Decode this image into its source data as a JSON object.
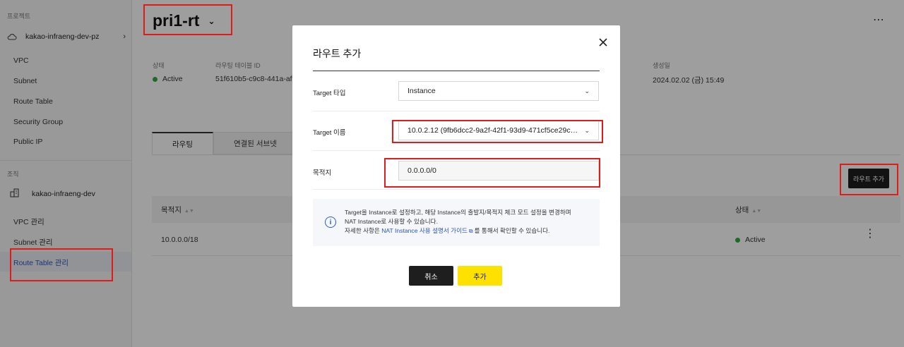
{
  "sidebar": {
    "project_section_label": "프로젝트",
    "project_name": "kakao-infraeng-dev-pz",
    "project_chevron": "›",
    "project_icon": "cloud-icon",
    "vpc_items": [
      "VPC",
      "Subnet",
      "Route Table",
      "Security Group",
      "Public IP"
    ],
    "org_section_label": "조직",
    "org_name": "kakao-infraeng-dev",
    "org_icon": "building-icon",
    "org_items": [
      "VPC 관리",
      "Subnet 관리",
      "Route Table 관리"
    ]
  },
  "header": {
    "title": "pri1-rt",
    "caret": "⌄",
    "more_menu": "⋯"
  },
  "meta": {
    "status_label": "상태",
    "status_value": "Active",
    "routing_table_id_label": "라우팅 테이블 ID",
    "routing_table_id_value": "51f610b5-c9c8-441a-afc",
    "created_label": "생성일",
    "created_value": "2024.02.02 (금) 15:49"
  },
  "tabs": [
    "라우팅",
    "연결된 서브넷"
  ],
  "toolbar": {
    "add_route_label": "라우트 추가"
  },
  "table": {
    "headers": [
      "목적지",
      "상태"
    ],
    "sort_icon": "▲▼",
    "rows": [
      {
        "destination": "10.0.0.0/18",
        "status": "Active"
      }
    ],
    "row_menu": "⋮"
  },
  "modal": {
    "title": "라우트 추가",
    "close_icon": "close-icon",
    "target_type_label": "Target 타입",
    "target_type_value": "Instance",
    "target_name_label": "Target 이름",
    "target_name_value": "10.0.2.12 (9fb6dcc2-9a2f-42f1-93d9-471cf5ce29c…",
    "destination_label": "목적지",
    "destination_value": "0.0.0.0/0",
    "info_line1": "Target을 Instance로 설정하고, 해당 Instance의 출발지/목적지 체크 모드 설정을 변경하며",
    "info_line2": "NAT Instance로 사용할 수 있습니다.",
    "info_line3_prefix": "자세한 사항은 ",
    "info_link": "NAT Instance 사용 설명서 가이드",
    "info_line3_suffix": "를 통해서 확인할 수 있습니다.",
    "info_icon_glyph": "i",
    "ext_icon_glyph": "⧉",
    "select_arrow": "⌄",
    "cancel_label": "취소",
    "add_label": "추가"
  },
  "colors": {
    "highlight": "#e01b1b",
    "primary_button": "#ffe100",
    "dark_button": "#1e1e1e",
    "active_status": "#35a944",
    "link": "#2a56c6"
  }
}
